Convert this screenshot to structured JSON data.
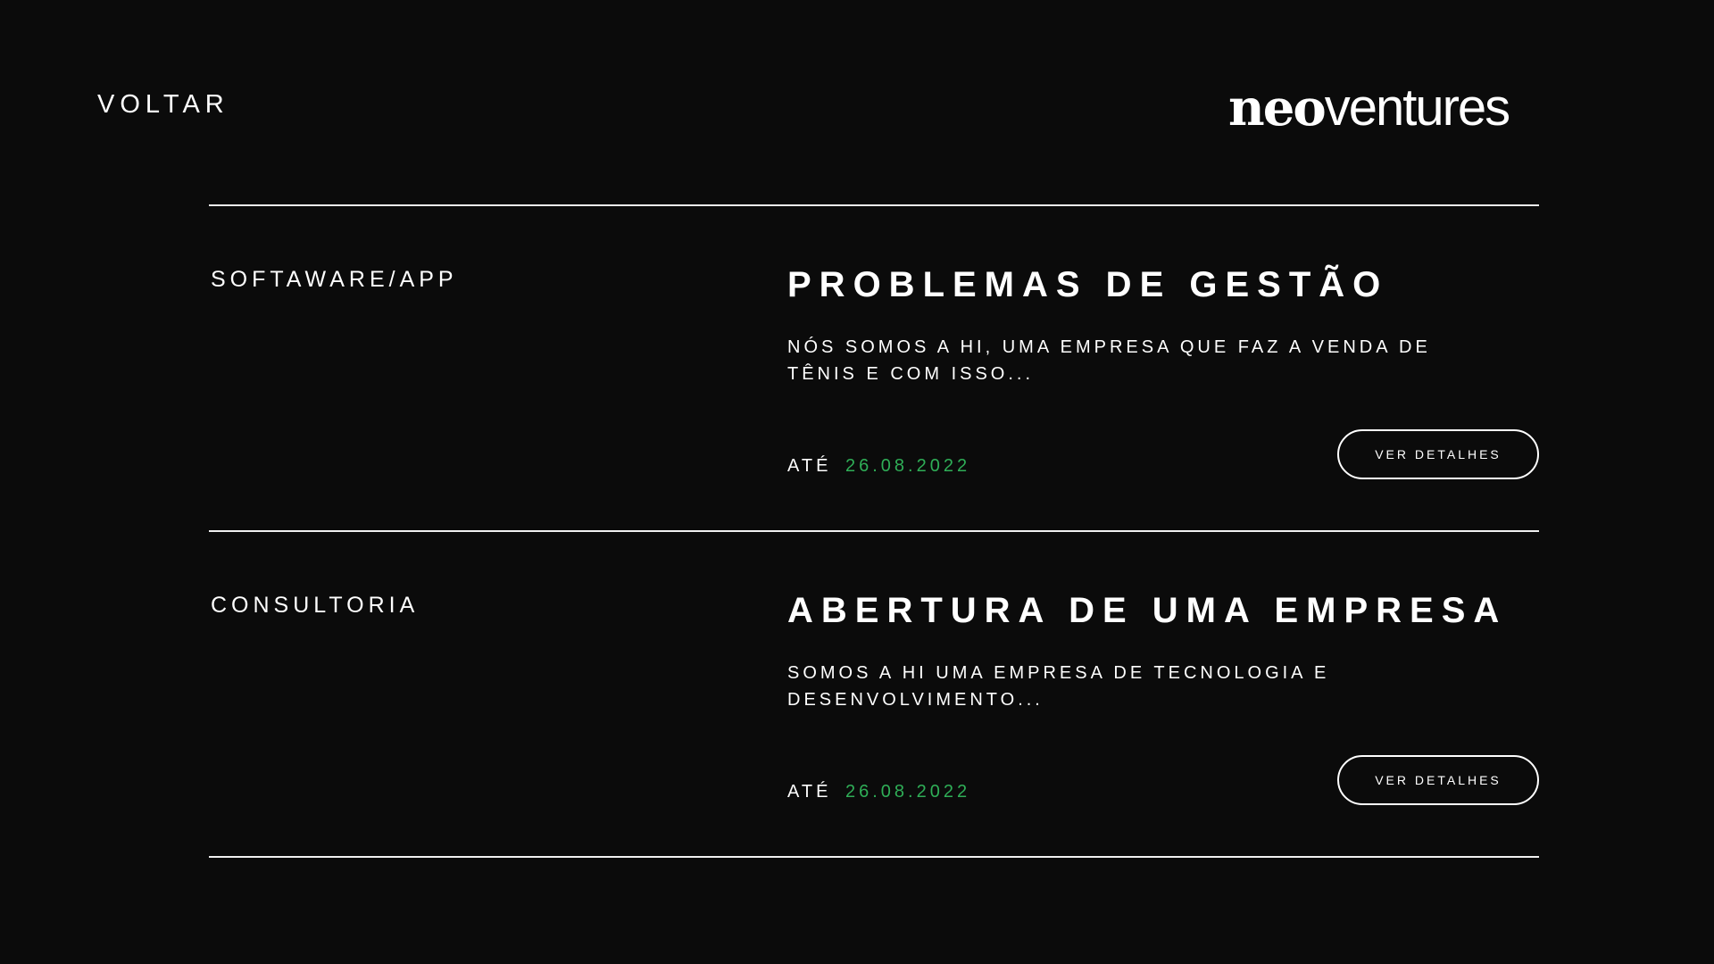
{
  "header": {
    "back_label": "VOLTAR",
    "logo": {
      "part1": "neo",
      "part2": "ventures"
    }
  },
  "items": [
    {
      "category": "SOFTAWARE/APP",
      "title": "PROBLEMAS DE GESTÃO",
      "description": "NÓS SOMOS A HI, UMA EMPRESA QUE FAZ A VENDA DE TÊNIS E COM ISSO...",
      "deadline_label": "ATÉ",
      "deadline_date": "26.08.2022",
      "button_label": "VER DETALHES"
    },
    {
      "category": "CONSULTORIA",
      "title": "ABERTURA DE UMA EMPRESA",
      "description": "SOMOS A HI UMA EMPRESA DE TECNOLOGIA E DESENVOLVIMENTO...",
      "deadline_label": "ATÉ",
      "deadline_date": "26.08.2022",
      "button_label": "VER DETALHES"
    }
  ],
  "colors": {
    "background": "#0b0b0b",
    "text": "#ffffff",
    "accent_date": "#2fae57"
  }
}
